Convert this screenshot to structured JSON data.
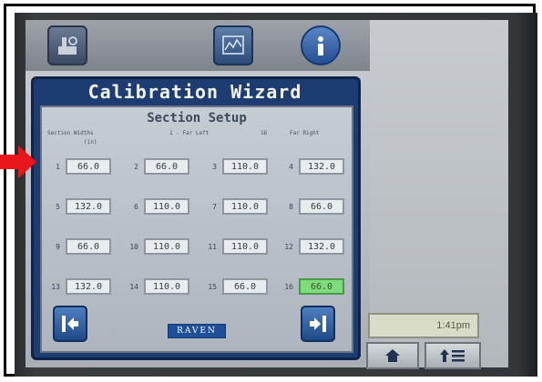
{
  "wizard": {
    "title": "Calibration Wizard",
    "subtitle": "Section Setup",
    "col_headers": [
      "Section Widths",
      "1 - Far Left",
      "16",
      "Far Right"
    ],
    "units": "(in)"
  },
  "sections": [
    {
      "num": "1",
      "value": "66.0"
    },
    {
      "num": "2",
      "value": "66.0"
    },
    {
      "num": "3",
      "value": "110.0"
    },
    {
      "num": "4",
      "value": "132.0"
    },
    {
      "num": "5",
      "value": "132.0"
    },
    {
      "num": "6",
      "value": "110.0"
    },
    {
      "num": "7",
      "value": "110.0"
    },
    {
      "num": "8",
      "value": "66.0"
    },
    {
      "num": "9",
      "value": "66.0"
    },
    {
      "num": "10",
      "value": "110.0"
    },
    {
      "num": "11",
      "value": "110.0"
    },
    {
      "num": "12",
      "value": "132.0"
    },
    {
      "num": "13",
      "value": "132.0"
    },
    {
      "num": "14",
      "value": "110.0"
    },
    {
      "num": "15",
      "value": "66.0"
    },
    {
      "num": "16",
      "value": "66.0"
    }
  ],
  "status": {
    "time": "1:41pm"
  },
  "brand": "RAVEN",
  "colors": {
    "dialog": "#1d3d72",
    "active_field": "#7fdc7c",
    "arrow": "#e8161b"
  },
  "icons": [
    "tools-icon",
    "performance-icon",
    "info-icon",
    "back-arrow-icon",
    "next-arrow-icon",
    "home-icon",
    "menu-icon"
  ]
}
